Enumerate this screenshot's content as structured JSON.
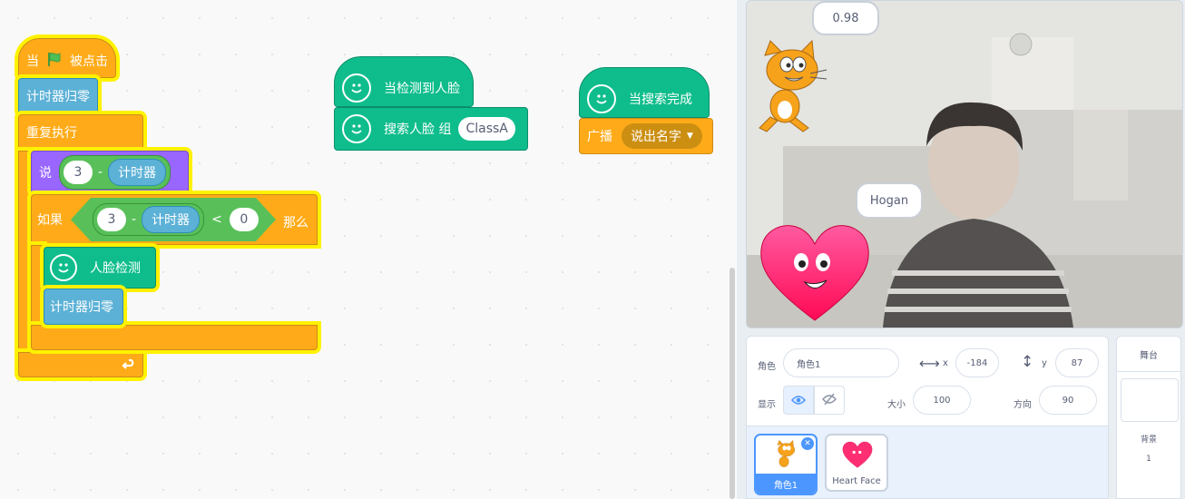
{
  "code": {
    "script1": {
      "hat_prefix": "当",
      "hat_suffix": "被点击",
      "reset_timer": "计时器归零",
      "forever": "重复执行",
      "say": "说",
      "say_num": "3",
      "minus": "-",
      "timer": "计时器",
      "if": "如果",
      "if_num": "3",
      "lt": "<",
      "zero": "0",
      "then": "那么",
      "face_detect": "人脸检测",
      "reset_timer2": "计时器归零"
    },
    "script2": {
      "hat": "当检测到人脸",
      "search": "搜索人脸 组",
      "group": "ClassA"
    },
    "script3": {
      "hat": "当搜索完成",
      "broadcast": "广播",
      "message": "说出名字"
    }
  },
  "stage": {
    "bubble_cat": "0.98",
    "bubble_heart": "Hogan"
  },
  "sprite_info": {
    "sprite_label": "角色",
    "sprite_name": "角色1",
    "x_label": "x",
    "x_value": "-184",
    "y_label": "y",
    "y_value": "87",
    "show_label": "显示",
    "size_label": "大小",
    "size_value": "100",
    "direction_label": "方向",
    "direction_value": "90"
  },
  "sprites": [
    {
      "name": "角色1",
      "selected": true
    },
    {
      "name": "Heart Face",
      "selected": false
    }
  ],
  "stage_panel": {
    "title": "舞台",
    "backdrops_label": "背景",
    "backdrops_count": "1"
  },
  "colors": {
    "events": "#ffab19",
    "sensing": "#5cb1d6",
    "looks": "#9966ff",
    "operators": "#59c059",
    "extension": "#0fbd8c",
    "glow": "#fff200",
    "selected": "#4c97ff"
  }
}
